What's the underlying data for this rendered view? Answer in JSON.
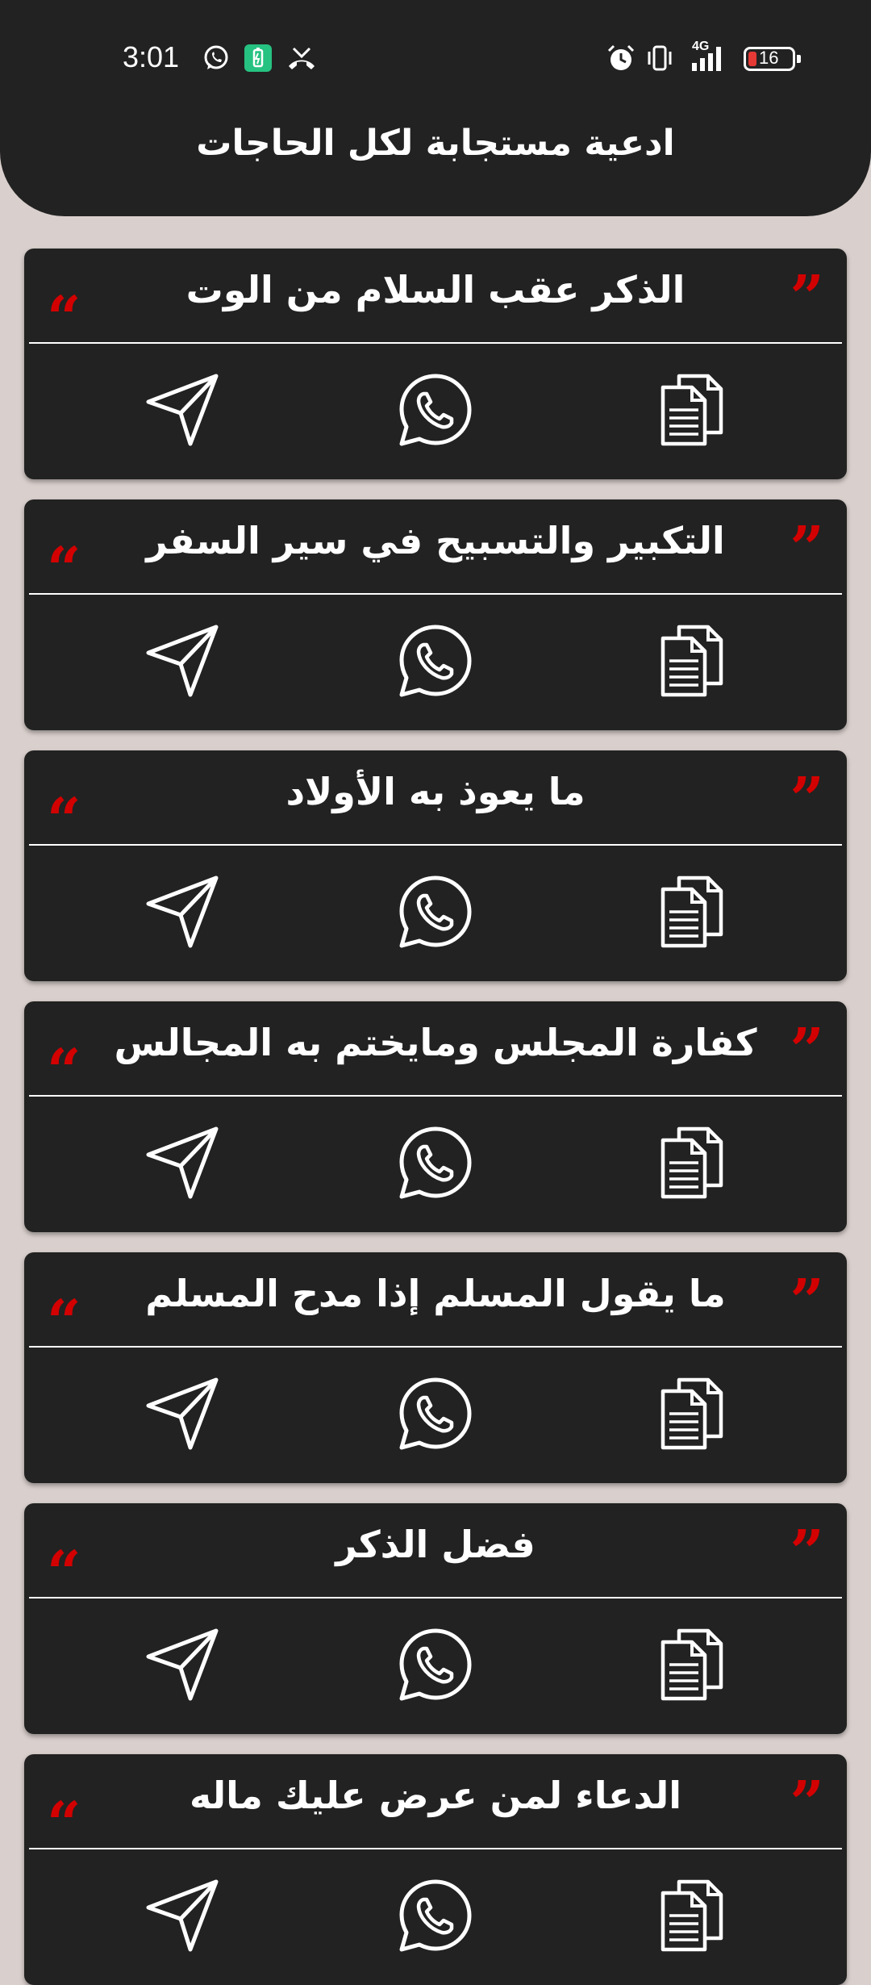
{
  "status_bar": {
    "time": "3:01",
    "battery_level": "16",
    "network": "4G",
    "icons": [
      "whatsapp-icon",
      "battery-saver-icon",
      "missed-call-icon",
      "alarm-icon",
      "vibrate-icon",
      "signal-icon",
      "battery-icon"
    ]
  },
  "header": {
    "title": "ادعية مستجابة لكل الحاجات"
  },
  "colors": {
    "background": "#d9cfcc",
    "card": "#222222",
    "accent_quote": "#d30000",
    "text": "#ffffff"
  },
  "items": [
    {
      "title": "الذكر عقب السلام من الوت"
    },
    {
      "title": "التكبير والتسبيح في سير السفر"
    },
    {
      "title": "ما يعوذ به الأولاد"
    },
    {
      "title": "كفارة المجلس ومايختم به المجالس"
    },
    {
      "title": "ما يقول المسلم إذا مدح المسلم"
    },
    {
      "title": "فضل الذكر"
    },
    {
      "title": "الدعاء لمن عرض عليك ماله"
    }
  ],
  "quote_marks": {
    "open": "“",
    "close": "”"
  },
  "actions": {
    "share_icon": "send-icon",
    "whatsapp_icon": "whatsapp-icon",
    "copy_icon": "copy-icon"
  }
}
